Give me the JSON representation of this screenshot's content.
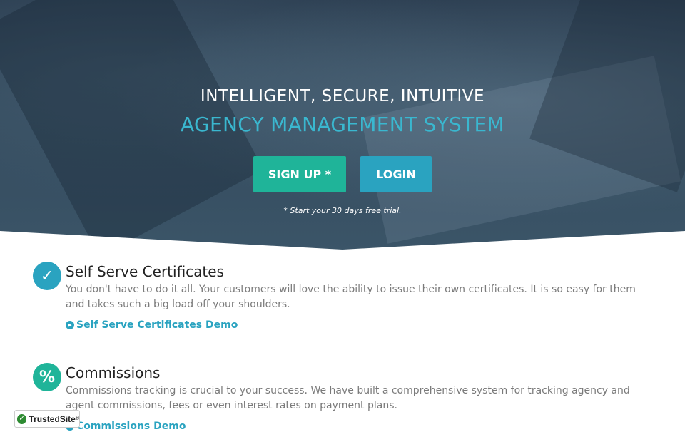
{
  "hero": {
    "subtitle": "INTELLIGENT, SECURE, INTUITIVE",
    "title": "AGENCY MANAGEMENT SYSTEM",
    "signup_label": "SIGN UP *",
    "login_label": "LOGIN",
    "trial_note": "* Start your 30 days free trial."
  },
  "features": [
    {
      "icon": "checkmark-icon",
      "icon_glyph": "✓",
      "title": "Self Serve Certificates",
      "description": "You don't have to do it all. Your customers will love the ability to issue their own certificates. It is so easy for them and takes such a big load off your shoulders.",
      "link": "Self Serve Certificates Demo"
    },
    {
      "icon": "percent-icon",
      "icon_glyph": "%",
      "title": "Commissions",
      "description": "Commissions tracking is crucial to your success. We have built a comprehensive system for tracking agency and agent commissions, fees or even interest rates on payment plans.",
      "link": "Commissions Demo"
    }
  ],
  "badge": {
    "label": "TrustedSite",
    "trademark": "®"
  },
  "colors": {
    "accent_blue": "#2aa3c0",
    "accent_green": "#1fb499",
    "hero_bg": "#33495c"
  }
}
